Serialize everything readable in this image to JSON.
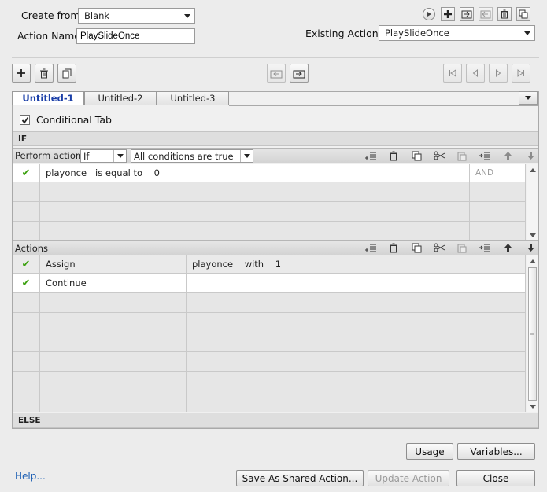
{
  "header": {
    "create_from_label": "Create from:",
    "create_from_value": "Blank",
    "action_name_label": "Action Name:",
    "action_name_value": "PlaySlideOnce",
    "existing_actions_label": "Existing Actions:",
    "existing_actions_value": "PlaySlideOnce"
  },
  "tabs": [
    {
      "label": "Untitled-1",
      "active": true
    },
    {
      "label": "Untitled-2",
      "active": false
    },
    {
      "label": "Untitled-3",
      "active": false
    }
  ],
  "conditional_tab": {
    "label": "Conditional Tab",
    "checked": true
  },
  "if_section": {
    "title": "IF",
    "perform_label": "Perform actions:",
    "perform_value": "If",
    "conditions_value": "All conditions are true",
    "rows": [
      {
        "checked": true,
        "condition": "playonce   is equal to    0",
        "op": "AND"
      },
      {
        "checked": false,
        "condition": "",
        "op": ""
      },
      {
        "checked": false,
        "condition": "",
        "op": ""
      },
      {
        "checked": false,
        "condition": "",
        "op": ""
      }
    ]
  },
  "actions_section": {
    "title": "Actions",
    "rows": [
      {
        "checked": true,
        "action": "Assign",
        "params": "playonce    with    1"
      },
      {
        "checked": true,
        "action": "Continue",
        "params": ""
      },
      {
        "checked": false,
        "action": "",
        "params": ""
      },
      {
        "checked": false,
        "action": "",
        "params": ""
      },
      {
        "checked": false,
        "action": "",
        "params": ""
      },
      {
        "checked": false,
        "action": "",
        "params": ""
      },
      {
        "checked": false,
        "action": "",
        "params": ""
      },
      {
        "checked": false,
        "action": "",
        "params": ""
      }
    ]
  },
  "else_section": {
    "title": "ELSE"
  },
  "footer": {
    "usage": "Usage",
    "variables": "Variables...",
    "help": "Help...",
    "save_shared": "Save As Shared Action...",
    "update": "Update Action",
    "close": "Close"
  },
  "colors": {
    "accent": "#1b3fa8",
    "check": "#3ba10e",
    "link": "#1d5fb4"
  }
}
